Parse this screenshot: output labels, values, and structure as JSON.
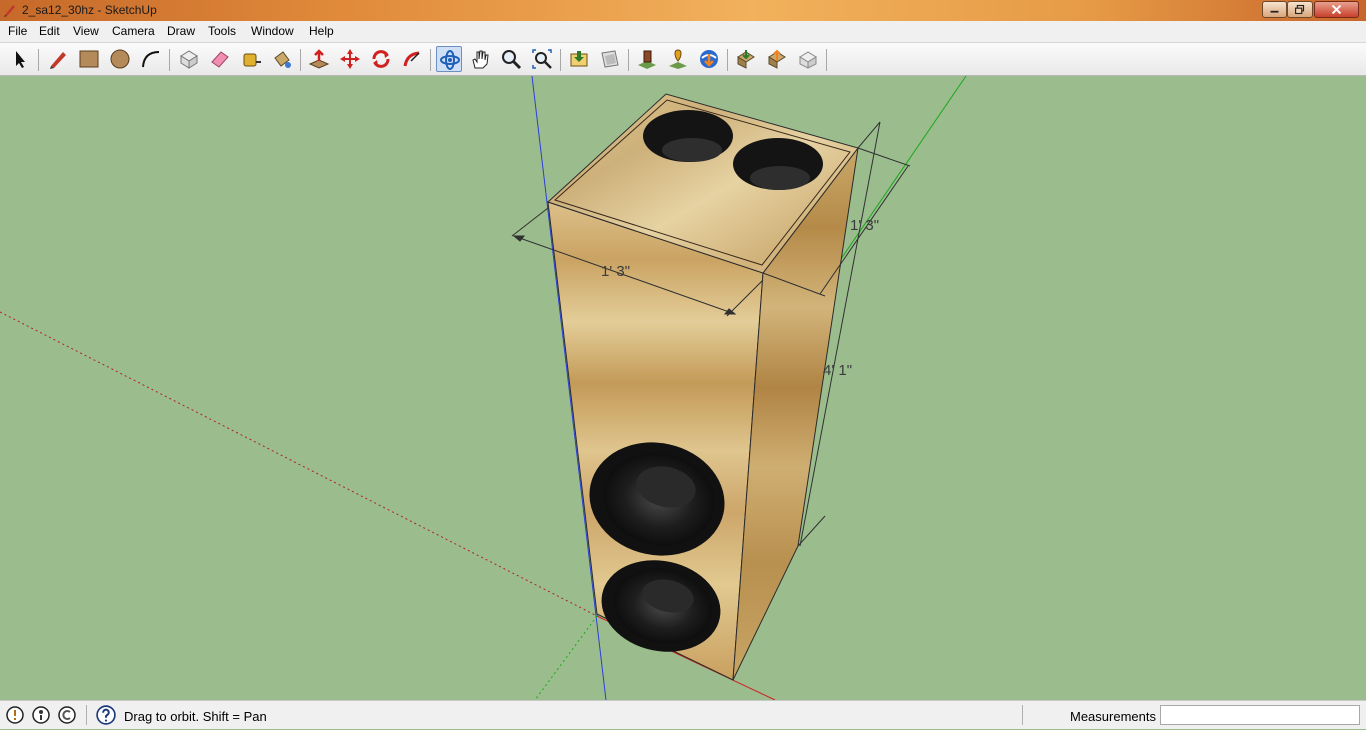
{
  "window": {
    "title": "2_sa12_30hz - SketchUp"
  },
  "menu": [
    "File",
    "Edit",
    "View",
    "Camera",
    "Draw",
    "Tools",
    "Window",
    "Help"
  ],
  "toolbar": {
    "tools": [
      "select-icon",
      "pencil-icon",
      "rectangle-icon",
      "circle-icon",
      "arc-icon",
      "make-component-icon",
      "eraser-icon",
      "tape-measure-icon",
      "paint-bucket-icon",
      "push-pull-icon",
      "move-icon",
      "rotate-icon",
      "follow-me-icon",
      "orbit-icon",
      "pan-icon",
      "zoom-icon",
      "zoom-extents-icon",
      "previous-view-icon",
      "next-view-icon",
      "add-location-icon",
      "toggle-terrain-icon",
      "get-models-icon",
      "share-model-icon",
      "get-component-icon",
      "share-component-icon",
      "extension-icon"
    ],
    "active_tool": "orbit-icon"
  },
  "viewport": {
    "dimensions": {
      "width_front": "1' 3\"",
      "width_side": "1' 3\"",
      "height": "4' 1\""
    }
  },
  "status": {
    "hint": "Drag to orbit.  Shift = Pan",
    "measurements_label": "Measurements",
    "measurements_value": ""
  },
  "colors": {
    "sky": "#9bbd8e",
    "wood": "#d9b877",
    "speaker": "#2a2a2a",
    "accent": "#6c8fbf"
  }
}
